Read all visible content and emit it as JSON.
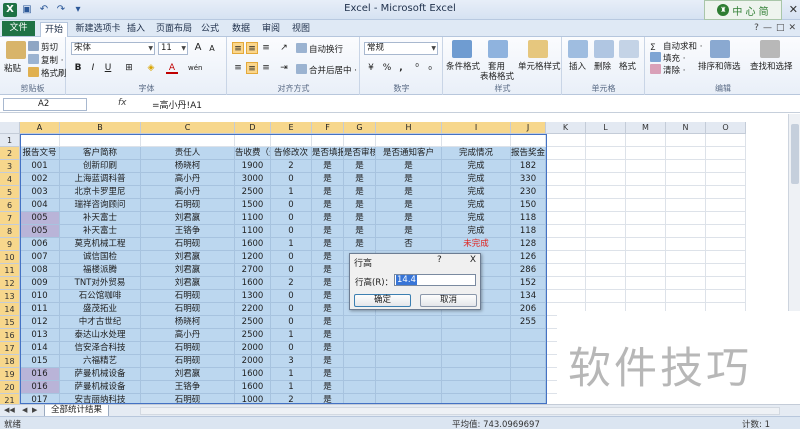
{
  "window": {
    "title": "Excel - Microsoft Excel",
    "watermark_brand": "中 心 简"
  },
  "tabs": {
    "file": "文件",
    "items": [
      "开始",
      "新建选项卡",
      "插入",
      "页面布局",
      "公式",
      "数据",
      "审阅",
      "视图"
    ],
    "active": "开始"
  },
  "ribbon": {
    "clipboard": {
      "label": "剪贴板",
      "paste": "粘贴",
      "cut": "剪切",
      "copy": "复制 ·",
      "format_painter": "格式刷"
    },
    "font": {
      "label": "字体",
      "font_name": "宋体",
      "font_size": "11",
      "bold": "B",
      "italic": "I",
      "underline": "U",
      "grow": "A",
      "shrink": "A",
      "wen": "wén"
    },
    "alignment": {
      "label": "对齐方式",
      "wrap_text": "自动换行",
      "merge_center": "合并后居中 ·"
    },
    "number": {
      "label": "数字",
      "format": "常规",
      "percent": "%",
      "comma": ",",
      "currency": "·"
    },
    "styles": {
      "label": "样式",
      "conditional": "条件格式",
      "table_format": "套用\n表格格式",
      "table_format_line1": "套用",
      "table_format_line2": "表格格式",
      "cell_styles": "单元格样式"
    },
    "cells": {
      "label": "单元格",
      "insert": "插入",
      "delete": "删除",
      "format": "格式"
    },
    "editing": {
      "label": "编辑",
      "autosum": "自动求和 ·",
      "fill": "填充 ·",
      "clear": "清除 ·",
      "sort_filter": "排序和筛选",
      "find_select": "查找和选择"
    }
  },
  "formula_bar": {
    "name_box": "A2",
    "fx": "fx",
    "formula": "=高小丹!A1"
  },
  "columns": [
    "A",
    "B",
    "C",
    "D",
    "E",
    "F",
    "G",
    "H",
    "I",
    "J",
    "K",
    "L",
    "M",
    "N",
    "O"
  ],
  "rows": [
    {
      "num": "1",
      "cells": [
        "",
        "",
        "",
        "",
        "",
        "",
        "",
        "",
        "",
        ""
      ]
    },
    {
      "num": "2",
      "cells": [
        "报告文号",
        "客户简称",
        "责任人",
        "告收费（元",
        "告修改次",
        "是否填报",
        "是否审核",
        "是否通知客户",
        "完成情况",
        "报告奖金"
      ]
    },
    {
      "num": "3",
      "cells": [
        "001",
        "创新印刷",
        "杨晓柯",
        "1900",
        "2",
        "是",
        "是",
        "是",
        "完成",
        "182"
      ]
    },
    {
      "num": "4",
      "cells": [
        "002",
        "上海蓝调科普",
        "高小丹",
        "3000",
        "0",
        "是",
        "是",
        "是",
        "完成",
        "330"
      ]
    },
    {
      "num": "5",
      "cells": [
        "003",
        "北京卡罗里尼",
        "高小丹",
        "2500",
        "1",
        "是",
        "是",
        "是",
        "完成",
        "230"
      ]
    },
    {
      "num": "6",
      "cells": [
        "004",
        "瑞祥咨询顾问",
        "石明砚",
        "1500",
        "0",
        "是",
        "是",
        "是",
        "完成",
        "150"
      ]
    },
    {
      "num": "7",
      "cells": [
        "005",
        "补天富士",
        "刘君嬴",
        "1100",
        "0",
        "是",
        "是",
        "是",
        "完成",
        "118"
      ]
    },
    {
      "num": "8",
      "cells": [
        "005",
        "补天富士",
        "王铬争",
        "1100",
        "0",
        "是",
        "是",
        "是",
        "完成",
        "118"
      ]
    },
    {
      "num": "9",
      "cells": [
        "006",
        "莫克机械工程",
        "石明砚",
        "1600",
        "1",
        "是",
        "是",
        "否",
        "未完成",
        "128"
      ]
    },
    {
      "num": "10",
      "cells": [
        "007",
        "诚信国检",
        "刘君嬴",
        "1200",
        "0",
        "是",
        "",
        "",
        "",
        "126"
      ]
    },
    {
      "num": "11",
      "cells": [
        "008",
        "福楼派腾",
        "刘君嬴",
        "2700",
        "0",
        "是",
        "",
        "",
        "",
        "286"
      ]
    },
    {
      "num": "12",
      "cells": [
        "009",
        "TNT对外贸易",
        "刘君嬴",
        "1600",
        "2",
        "是",
        "",
        "",
        "",
        "152"
      ]
    },
    {
      "num": "13",
      "cells": [
        "010",
        "石公馆咖啡",
        "石明砚",
        "1300",
        "0",
        "是",
        "",
        "",
        "",
        "134"
      ]
    },
    {
      "num": "14",
      "cells": [
        "011",
        "盛茂拓业",
        "石明砚",
        "2200",
        "0",
        "是",
        "",
        "",
        "",
        "206"
      ]
    },
    {
      "num": "15",
      "cells": [
        "012",
        "中才古世纪",
        "杨晓柯",
        "2500",
        "0",
        "是",
        "",
        "",
        "",
        "255"
      ]
    },
    {
      "num": "16",
      "cells": [
        "013",
        "泰达山水处理",
        "高小丹",
        "2500",
        "1",
        "是",
        "",
        "",
        "",
        ""
      ]
    },
    {
      "num": "17",
      "cells": [
        "014",
        "信安泽合科技",
        "石明砚",
        "2000",
        "0",
        "是",
        "",
        "",
        "",
        ""
      ]
    },
    {
      "num": "18",
      "cells": [
        "015",
        "六福精艺",
        "石明砚",
        "2000",
        "3",
        "是",
        "",
        "",
        "",
        ""
      ]
    },
    {
      "num": "19",
      "cells": [
        "016",
        "萨曼机械设备",
        "刘君嬴",
        "1600",
        "1",
        "是",
        "",
        "",
        "",
        ""
      ]
    },
    {
      "num": "20",
      "cells": [
        "016",
        "萨曼机械设备",
        "王铬争",
        "1600",
        "1",
        "是",
        "",
        "",
        "",
        ""
      ]
    },
    {
      "num": "21",
      "cells": [
        "017",
        "安吉丽纳科技",
        "石明砚",
        "1000",
        "2",
        "是",
        "",
        "",
        "",
        ""
      ]
    },
    {
      "num": "22",
      "cells": [
        "",
        "",
        "",
        "",
        "",
        "",
        "",
        "",
        "",
        ""
      ]
    }
  ],
  "dialog": {
    "title": "行高",
    "help": "?",
    "close": "X",
    "label": "行高(R)：",
    "value": "14.4",
    "ok": "确定",
    "cancel": "取消"
  },
  "sheet_tabs": {
    "active": "全部统计结果"
  },
  "status": {
    "ready": "就绪",
    "average": "平均值: 743.0969697",
    "count": "计数: 1"
  },
  "watermark": {
    "text": "软件技巧"
  },
  "colors": {
    "selection": "#bcd7ef",
    "duplicate_highlight": "#b9b4d8",
    "file_tab": "#1f7244",
    "incomplete_text": "#e0201b"
  }
}
